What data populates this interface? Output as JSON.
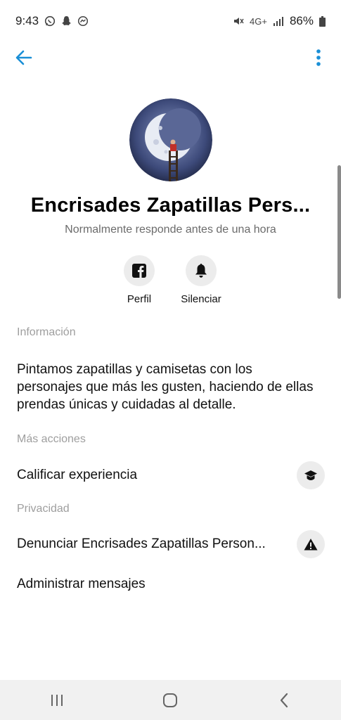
{
  "status_bar": {
    "time": "9:43",
    "battery": "86%",
    "icons_left": [
      "whatsapp-icon",
      "snapchat-icon",
      "messenger-icon"
    ],
    "icons_right": [
      "mute-icon",
      "4g-icon",
      "signal-icon",
      "battery-icon"
    ],
    "network_label": "4G+"
  },
  "header": {
    "back_icon": "arrow-left-icon",
    "menu_icon": "more-vertical-icon",
    "accent": "#1a8fd6"
  },
  "profile": {
    "name": "Encrisades Zapatillas Pers...",
    "subtitle": "Normalmente responde antes de una hora",
    "avatar_icon": "moon-ladder-avatar"
  },
  "actions": [
    {
      "label": "Perfil",
      "icon": "facebook-icon"
    },
    {
      "label": "Silenciar",
      "icon": "bell-icon"
    }
  ],
  "info": {
    "title": "Información",
    "text": "Pintamos zapatillas y camisetas con los personajes que más les gusten, haciendo de ellas prendas únicas y cuidadas al detalle."
  },
  "more_actions": {
    "title": "Más acciones",
    "rate_label": "Calificar experiencia",
    "rate_icon": "graduation-cap-icon"
  },
  "privacy": {
    "title": "Privacidad",
    "report_label": "Denunciar Encrisades Zapatillas Person...",
    "report_icon": "warning-icon",
    "manage_label": "Administrar mensajes"
  },
  "nav": {
    "icons": [
      "recent-apps-icon",
      "home-icon",
      "back-icon"
    ]
  }
}
